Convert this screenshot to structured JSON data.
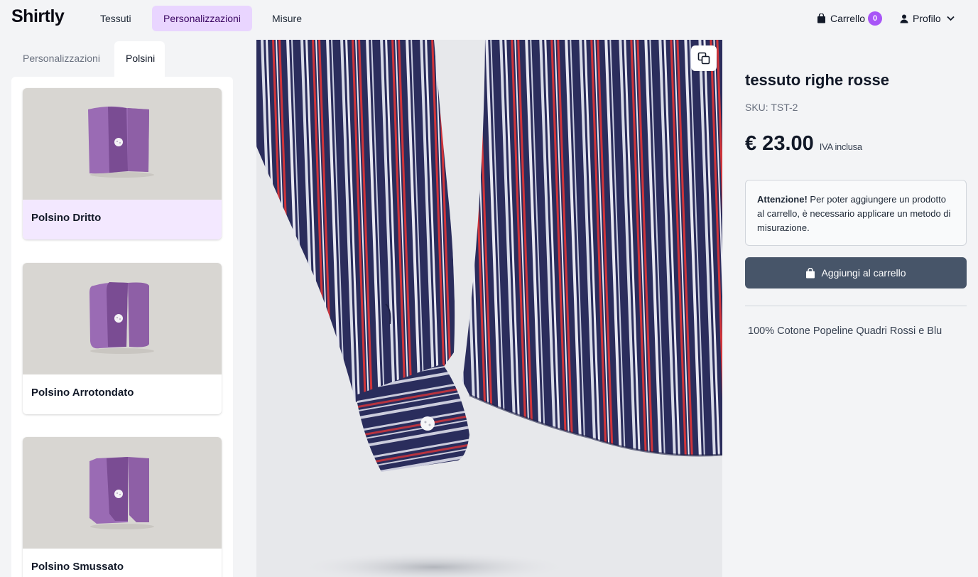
{
  "header": {
    "logo": "Shirtly",
    "nav": [
      {
        "label": "Tessuti",
        "active": false
      },
      {
        "label": "Personalizzazioni",
        "active": true
      },
      {
        "label": "Misure",
        "active": false
      }
    ],
    "cart_label": "Carrello",
    "cart_count": "0",
    "profile_label": "Profilo"
  },
  "sidebar": {
    "tabs": [
      {
        "label": "Personalizzazioni",
        "active": false
      },
      {
        "label": "Polsini",
        "active": true
      }
    ],
    "items": [
      {
        "label": "Polsino Dritto",
        "selected": true,
        "style": "straight"
      },
      {
        "label": "Polsino Arrotondato",
        "selected": false,
        "style": "rounded"
      },
      {
        "label": "Polsino Smussato",
        "selected": false,
        "style": "beveled"
      }
    ]
  },
  "product": {
    "title": "tessuto righe rosse",
    "sku": "SKU: TST-2",
    "price": "€ 23.00",
    "vat": "IVA inclusa",
    "notice_strong": "Attenzione!",
    "notice_text": " Per poter aggiungere un prodotto al carrello, è necessario applicare un metodo di misurazione.",
    "add_button": "Aggiungi al carrello",
    "description": "100% Cotone Popeline Quadri Rossi e Blu"
  },
  "colors": {
    "accent": "#a855f7",
    "nav_active_bg": "#e9d5ff",
    "shirt_navy": "#2b2d5c",
    "stripe_red": "#d0343a",
    "stripe_white": "#e8e8f2",
    "cuff_purple": "#8e5fa6",
    "button_dark": "#475569"
  },
  "icons": {
    "cart": "shopping-bag-icon",
    "profile": "user-icon",
    "dropdown": "chevron-down-icon",
    "viewer": "copy-icon"
  }
}
